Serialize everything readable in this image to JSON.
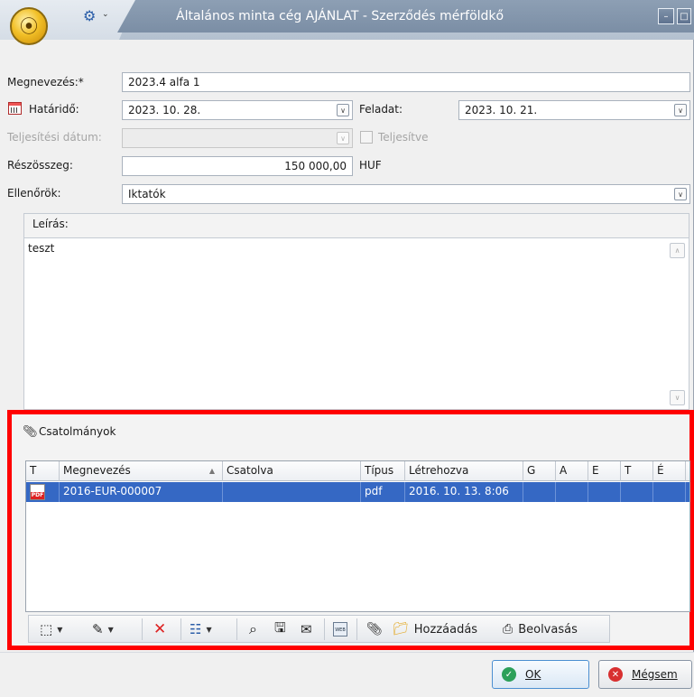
{
  "window": {
    "title": "Általános minta cég AJÁNLAT - Szerződés mérföldkő"
  },
  "form": {
    "name_label": "Megnevezés:*",
    "name_value": "2023.4 alfa 1",
    "deadline_label": "Határidő:",
    "deadline_value": "2023. 10. 28.",
    "task_label": "Feladat:",
    "task_value": "2023. 10. 21.",
    "completion_label": "Teljesítési dátum:",
    "completion_value": "",
    "completed_label": "Teljesítve",
    "completed_checked": false,
    "amount_label": "Részösszeg:",
    "amount_value": "150 000,00",
    "currency": "HUF",
    "controllers_label": "Ellenőrök:",
    "controllers_value": "Iktatók"
  },
  "description": {
    "caption": "Leírás:",
    "text": "teszt"
  },
  "attachments": {
    "caption": "Csatolmányok",
    "columns": [
      "T",
      "Megnevezés",
      "Csatolva",
      "Típus",
      "Létrehozva",
      "G",
      "A",
      "E",
      "T",
      "É"
    ],
    "rows": [
      {
        "icon": "pdf-file-icon",
        "name": "2016-EUR-000007",
        "attached": "",
        "type": "pdf",
        "created": "2016. 10. 13. 8:06",
        "g": "",
        "a": "",
        "e": "",
        "t": "",
        "e2": ""
      }
    ],
    "toolbar": {
      "add_label": "Hozzáadás",
      "scan_label": "Beolvasás"
    }
  },
  "buttons": {
    "ok_label": "OK",
    "cancel_label": "Mégsem"
  },
  "colors": {
    "selection": "#3568c4",
    "highlight_border": "#ff0000",
    "title_text": "#ffffff"
  }
}
